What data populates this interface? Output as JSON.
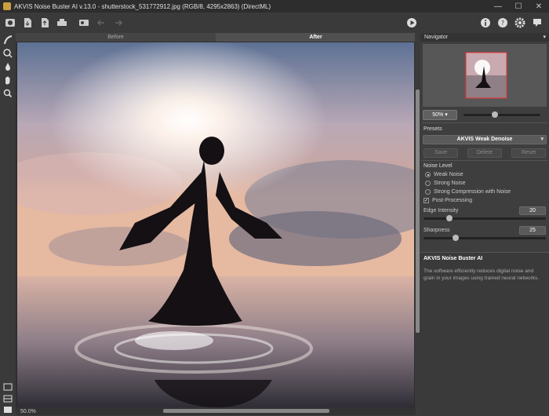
{
  "window": {
    "title": "AKVIS Noise Buster AI v.13.0 - shutterstock_531772912.jpg (RGB/8, 4295x2863) (DirectML)",
    "min": "—",
    "max": "☐",
    "close": "✕"
  },
  "toolbar": {
    "icons": [
      "home-icon",
      "open-icon",
      "save-icon",
      "print-icon",
      "batch-icon",
      "undo-icon",
      "redo-icon",
      "run-icon",
      "info-icon",
      "help-icon",
      "settings-icon",
      "notifications-icon"
    ]
  },
  "tabs": {
    "before": "Before",
    "after": "After"
  },
  "status": {
    "zoom": "50.0%"
  },
  "navigator": {
    "header": "Navigator",
    "zoom": "50% ▾",
    "zoom_level": 0.4
  },
  "presets": {
    "label": "Presets",
    "selected": "AKVIS Weak Denoise",
    "save": "Save",
    "delete": "Delete",
    "reset": "Reset"
  },
  "noise_level": {
    "label": "Noise Level",
    "options": [
      "Weak Noise",
      "Strong Noise",
      "Strong Compression with Noise"
    ],
    "selected": 0
  },
  "post_processing": {
    "label": "Post-Processing",
    "checked": true
  },
  "edge_intensity": {
    "label": "Edge Intensity",
    "value": "20",
    "level": 0.2
  },
  "sharpness": {
    "label": "Sharpness",
    "value": "25",
    "level": 0.25
  },
  "info": {
    "title": "AKVIS Noise Buster AI",
    "description": "The software efficiently reduces digital noise and grain in your images using trained neural networks."
  }
}
